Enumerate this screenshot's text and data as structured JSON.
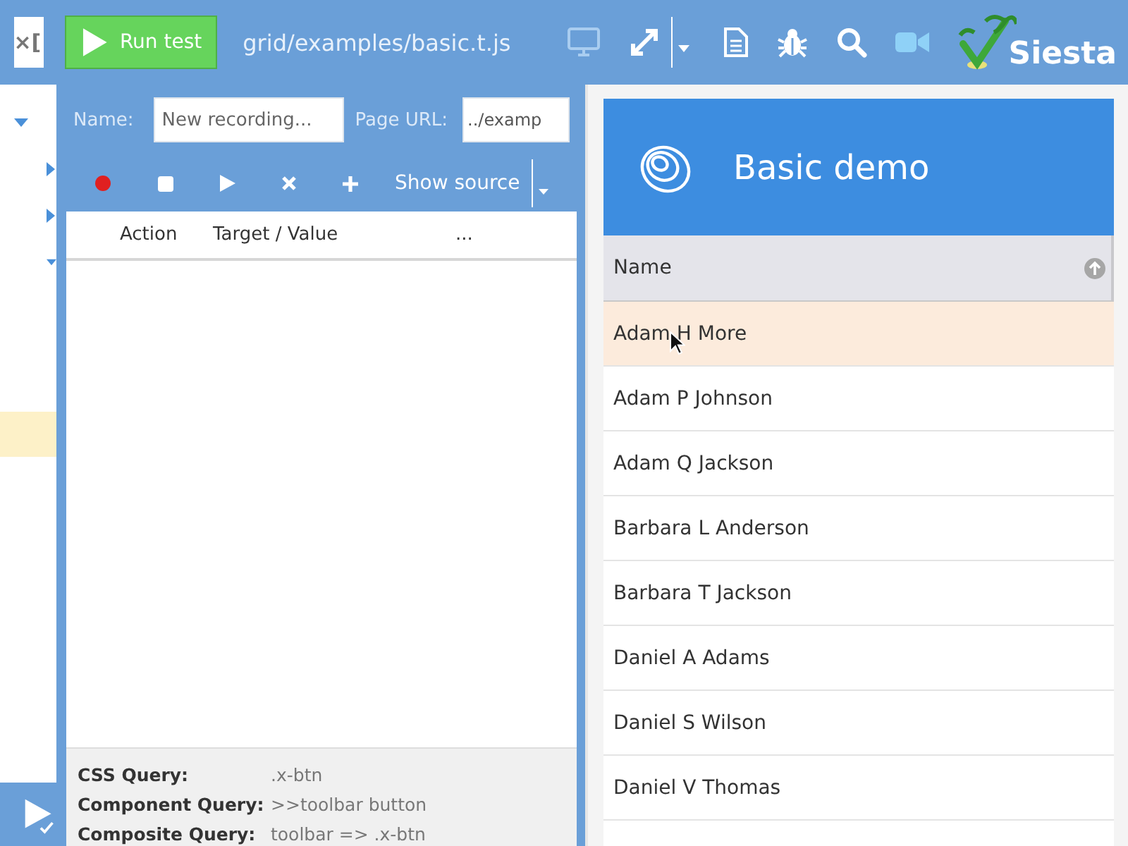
{
  "top_bar": {
    "tab_label": "×[",
    "run_button": "Run test",
    "test_path": "grid/examples/basic.t.js",
    "logo_text": "Siesta"
  },
  "tree": {
    "rows": [
      {
        "kind": "expanded"
      },
      {
        "kind": "collapsed"
      },
      {
        "kind": "collapsed"
      },
      {
        "kind": "expanded"
      }
    ],
    "highlighted_row": true
  },
  "recorder": {
    "name_label": "Name:",
    "name_placeholder": "New recording...",
    "url_label": "Page URL:",
    "url_value": "../examp",
    "show_source": "Show source",
    "columns": [
      "Action",
      "Target / Value",
      "..."
    ],
    "queries": [
      {
        "label": "CSS Query:",
        "value": ".x-btn"
      },
      {
        "label": "Component Query:",
        "value": ">>toolbar button"
      },
      {
        "label": "Composite Query:",
        "value": "toolbar => .x-btn"
      }
    ]
  },
  "demo": {
    "title": "Basic demo",
    "column": "Name",
    "rows": [
      {
        "name": "Adam H More",
        "highlighted": true
      },
      {
        "name": "Adam P Johnson",
        "highlighted": false
      },
      {
        "name": "Adam Q Jackson",
        "highlighted": false
      },
      {
        "name": "Barbara L Anderson",
        "highlighted": false
      },
      {
        "name": "Barbara T Jackson",
        "highlighted": false
      },
      {
        "name": "Daniel A Adams",
        "highlighted": false
      },
      {
        "name": "Daniel S Wilson",
        "highlighted": false
      },
      {
        "name": "Daniel V Thomas",
        "highlighted": false
      }
    ]
  }
}
